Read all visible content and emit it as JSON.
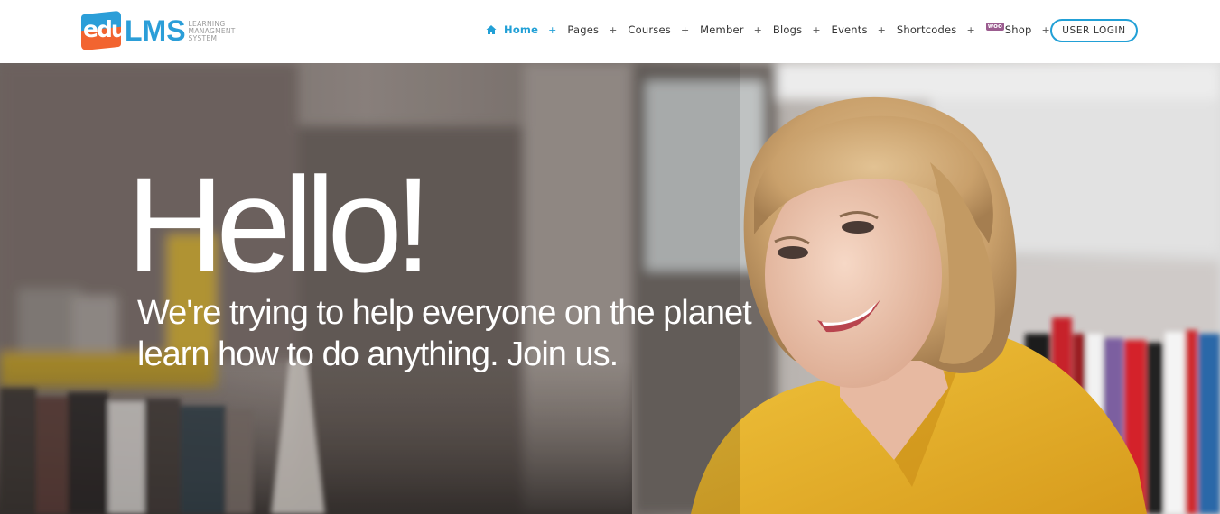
{
  "logo": {
    "badge": "edu",
    "name": "LMS",
    "tagline": [
      "LEARNING",
      "MANAGMENT",
      "SYSTEM"
    ]
  },
  "nav": {
    "items": [
      {
        "label": "Home",
        "icon": "home-icon",
        "active": true
      },
      {
        "label": "Pages"
      },
      {
        "label": "Courses"
      },
      {
        "label": "Member"
      },
      {
        "label": "Blogs"
      },
      {
        "label": "Events"
      },
      {
        "label": "Shortcodes"
      },
      {
        "label": "Shop",
        "badge": "woo"
      }
    ],
    "expand_symbol": "+",
    "login_label": "USER LOGIN"
  },
  "hero": {
    "title": "Hello!",
    "subtitle_line1": "We're trying to help everyone on the planet",
    "subtitle_line2": "learn how to do anything. Join us."
  },
  "colors": {
    "accent": "#22a0d6",
    "logo_blue": "#2b9ed8",
    "logo_orange": "#f26430",
    "woo_purple": "#9b5c8f",
    "shirt_yellow": "#e8b22a"
  }
}
